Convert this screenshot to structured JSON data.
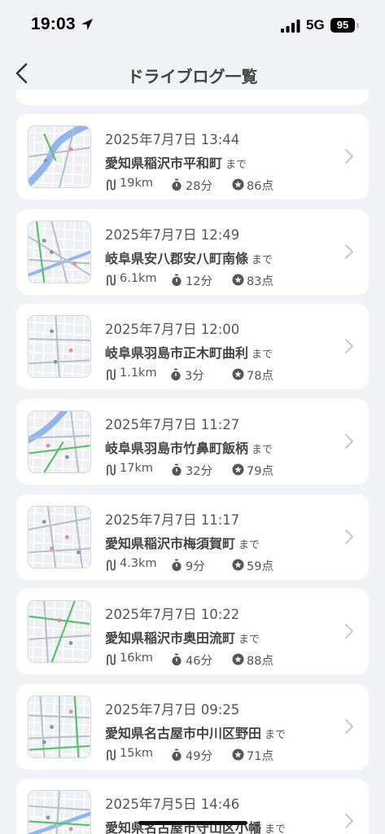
{
  "status_bar": {
    "time": "19:03",
    "network": "5G",
    "battery": "95"
  },
  "nav": {
    "title": "ドライブログ一覧"
  },
  "suffix": "まで",
  "trips": [
    {
      "date": "2025年7月7日 13:44",
      "destination": "愛知県稲沢市平和町",
      "distance": "19km",
      "duration": "28分",
      "score": "86点"
    },
    {
      "date": "2025年7月7日 12:49",
      "destination": "岐阜県安八郡安八町南條",
      "distance": "6.1km",
      "duration": "12分",
      "score": "83点"
    },
    {
      "date": "2025年7月7日 12:00",
      "destination": "岐阜県羽島市正木町曲利",
      "distance": "1.1km",
      "duration": "3分",
      "score": "78点"
    },
    {
      "date": "2025年7月7日 11:27",
      "destination": "岐阜県羽島市竹鼻町飯柄",
      "distance": "17km",
      "duration": "32分",
      "score": "79点"
    },
    {
      "date": "2025年7月7日 11:17",
      "destination": "愛知県稲沢市梅須賀町",
      "distance": "4.3km",
      "duration": "9分",
      "score": "59点"
    },
    {
      "date": "2025年7月7日 10:22",
      "destination": "愛知県稲沢市奥田流町",
      "distance": "16km",
      "duration": "46分",
      "score": "88点"
    },
    {
      "date": "2025年7月7日 09:25",
      "destination": "愛知県名古屋市中川区野田",
      "distance": "15km",
      "duration": "49分",
      "score": "71点"
    },
    {
      "date": "2025年7月5日 14:46",
      "destination": "愛知県名古屋市守山区小幡",
      "distance": "",
      "duration": "",
      "score": ""
    }
  ]
}
